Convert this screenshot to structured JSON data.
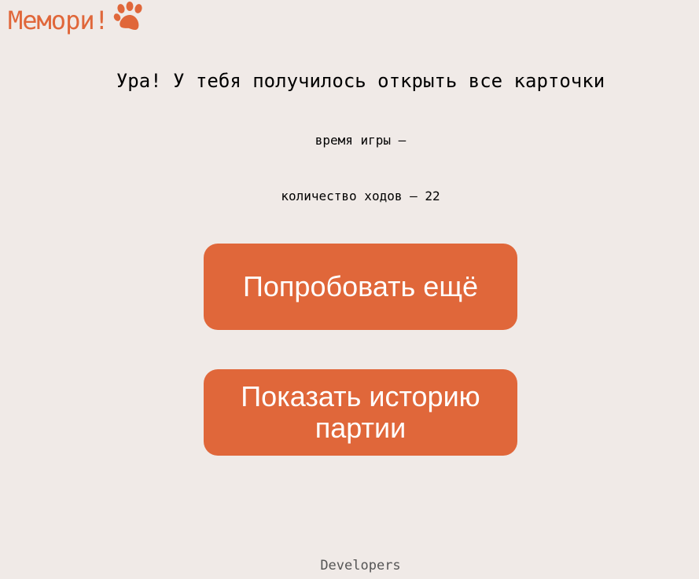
{
  "header": {
    "logo_text": "Мемори!",
    "logo_icon": "paw-icon",
    "accent_color": "#e0673a"
  },
  "result": {
    "title": "Ура! У тебя получилось открыть все карточки",
    "time_text": "время игры —",
    "moves_text": "количество ходов — 22"
  },
  "actions": {
    "retry_label": "Попробовать ещё",
    "history_label": "Показать историю партии"
  },
  "footer": {
    "link_label": "Developers"
  }
}
